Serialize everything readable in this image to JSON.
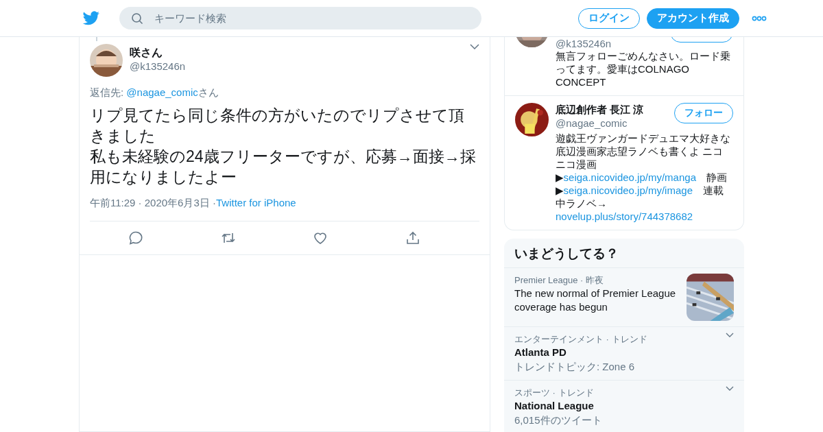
{
  "header": {
    "search": {
      "placeholder": "キーワード検索"
    },
    "buttons": [
      {
        "label": "ログイン",
        "kind": "outline"
      },
      {
        "label": "アカウント作成",
        "kind": "filled"
      }
    ]
  },
  "tweet": {
    "name": "咲さん",
    "handle": "@k135246n",
    "reply_label": "返信先: ",
    "reply_to": "@nagae_comic",
    "reply_suffix": "さん",
    "text": [
      "リプ見てたら同じ条件の方がいたのでリプさせて頂きました",
      "私も未経験の24歳フリーターですが、応募→面接→採用になりましたよー"
    ],
    "timestamp": "午前11:29 · 2020年6月3日 · ",
    "source": "Twitter for iPhone"
  },
  "profiles": [
    {
      "kind": "cut",
      "handle": "@k135246n",
      "bio": [
        {
          "kind": "text",
          "text": "無言フォローごめんなさい。ロード乗ってます。愛車はCOLNAGO CONCEPT"
        }
      ]
    },
    {
      "kind": "full",
      "name": "底辺創作者 長江 涼",
      "handle": "@nagae_comic",
      "follow": "フォロー",
      "bio": [
        {
          "kind": "text",
          "text": "遊戯王ヴァンガードデュエマ大好きな底辺漫画家志望ラノベも書くよ ニコニコ漫画\n▶"
        },
        {
          "kind": "link",
          "text": "seiga.nicovideo.jp/my/manga"
        },
        {
          "kind": "text",
          "text": "　静画\n▶"
        },
        {
          "kind": "link",
          "text": "seiga.nicovideo.jp/my/image"
        },
        {
          "kind": "text",
          "text": "　連載中ラノベ→\n"
        },
        {
          "kind": "link",
          "text": "novelup.plus/story/744378682"
        }
      ]
    }
  ],
  "trends": {
    "title": "いまどうしてる？",
    "items": [
      {
        "kind": "news",
        "meta": "Premier League · 昨夜",
        "title": "The new normal of Premier League coverage has begun"
      },
      {
        "kind": "trend",
        "meta": "エンターテインメント · トレンド",
        "title": "Atlanta PD",
        "sub": "トレンドトピック: Zone 6"
      },
      {
        "kind": "trend",
        "meta": "スポーツ · トレンド",
        "title": "National League",
        "sub": "6,015件のツイート"
      }
    ]
  }
}
